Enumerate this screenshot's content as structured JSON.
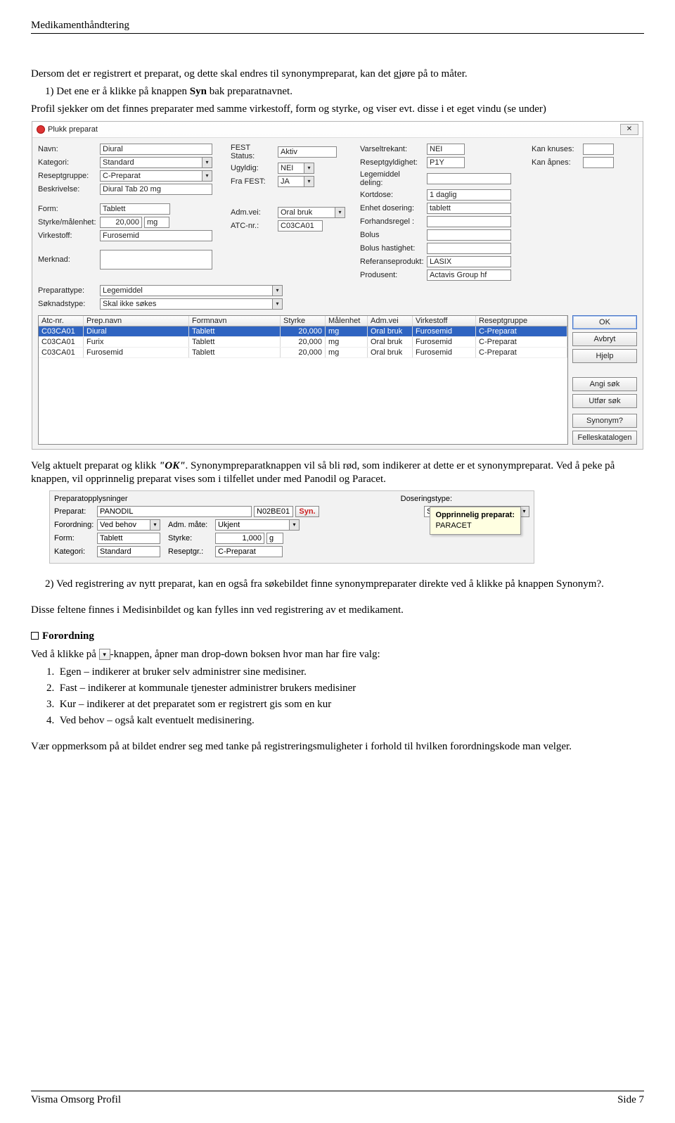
{
  "header": "Medikamenthåndtering",
  "para1": "Dersom det er registrert et preparat, og dette skal endres til synonympreparat, kan det gjøre på to måter.",
  "item1_prefix": "1)   Det ene er å klikke på knappen ",
  "item1_bold": "Syn",
  "item1_suffix": " bak preparatnavnet.",
  "para2": "Profil sjekker om det finnes preparater med samme virkestoff, form og styrke, og viser evt. disse i et eget vindu (se under)",
  "dlg1": {
    "title": "Plukk preparat",
    "close": "✕",
    "labels": {
      "navn": "Navn:",
      "kategori": "Kategori:",
      "reseptgruppe": "Reseptgruppe:",
      "beskrivelse": "Beskrivelse:",
      "form": "Form:",
      "styrke": "Styrke/målenhet:",
      "virkestoff": "Virkestoff:",
      "merknad": "Merknad:",
      "festStatus": "FEST Status:",
      "ugyldig": "Ugyldig:",
      "fraFest": "Fra FEST:",
      "admvei": "Adm.vei:",
      "atc": "ATC-nr.:",
      "varseltrekant": "Varseltrekant:",
      "reseptgyldighet": "Reseptgyldighet:",
      "legemiddeldeling": "Legemiddel deling:",
      "kortdose": "Kortdose:",
      "enhetdosering": "Enhet dosering:",
      "forhandsregel": "Forhandsregel :",
      "bolus": "Bolus",
      "bolushast": "Bolus hastighet:",
      "referanse": "Referanseprodukt:",
      "produsent": "Produsent:",
      "kanknuses": "Kan knuses:",
      "kanapnes": "Kan åpnes:",
      "preparattype": "Preparattype:",
      "soknadstype": "Søknadstype:"
    },
    "vals": {
      "navn": "Diural",
      "kategori": "Standard",
      "reseptgruppe": "C-Preparat",
      "beskrivelse": "Diural Tab 20 mg",
      "form": "Tablett",
      "styrke": "20,000",
      "styrkeUnit": "mg",
      "virkestoff": "Furosemid",
      "festStatus": "Aktiv",
      "ugyldig": "NEI",
      "fraFest": "JA",
      "admvei": "Oral bruk",
      "atc": "C03CA01",
      "varseltrekant": "NEI",
      "reseptgyldighet": "P1Y",
      "kortdose": "1 daglig",
      "enhetdosering": "tablett",
      "referanse": "LASIX",
      "produsent": "Actavis Group hf",
      "preparattype": "Legemiddel",
      "soknadstype": "Skal ikke søkes"
    },
    "grid": {
      "headers": [
        "Atc-nr.",
        "Prep.navn",
        "Formnavn",
        "Styrke",
        "Målenhet",
        "Adm.vei",
        "Virkestoff",
        "Reseptgruppe"
      ],
      "rows": [
        [
          "C03CA01",
          "Diural",
          "Tablett",
          "20,000",
          "mg",
          "Oral bruk",
          "Furosemid",
          "C-Preparat"
        ],
        [
          "C03CA01",
          "Furix",
          "Tablett",
          "20,000",
          "mg",
          "Oral bruk",
          "Furosemid",
          "C-Preparat"
        ],
        [
          "C03CA01",
          "Furosemid",
          "Tablett",
          "20,000",
          "mg",
          "Oral bruk",
          "Furosemid",
          "C-Preparat"
        ]
      ]
    },
    "buttons": {
      "ok": "OK",
      "avbryt": "Avbryt",
      "hjelp": "Hjelp",
      "angi": "Angi søk",
      "utfor": "Utfør søk",
      "synonym": "Synonym?",
      "felles": "Felleskatalogen"
    }
  },
  "para3_a": "Velg aktuelt preparat og klikk ",
  "para3_ok": "\"OK\"",
  "para3_b": ". Synonympreparatknappen vil så bli rød, som indikerer at dette er et synonympreparat. Ved å peke på knappen, vil opprinnelig preparat vises som i tilfellet under med Panodil og Paracet.",
  "dlg2": {
    "title": "Preparatopplysninger",
    "doseringstype": "Doseringstype:",
    "labels": {
      "preparat": "Preparat:",
      "forordning": "Forordning:",
      "form": "Form:",
      "kategori": "Kategori:",
      "admmate": "Adm. måte:",
      "styrke": "Styrke:",
      "reseptgr": "Reseptgr.:"
    },
    "vals": {
      "preparat": "PANODIL",
      "atc": "N02BE01",
      "syn": "Syn.",
      "doseringstype": "Standard",
      "forordning": "Ved behov",
      "admmate": "Ukjent",
      "form": "Tablett",
      "styrke": "1,000",
      "styrkeUnit": "g",
      "kategori": "Standard",
      "reseptgr": "C-Preparat"
    },
    "tooltip": {
      "line1": "Opprinnelig preparat:",
      "line2": "PARACET"
    }
  },
  "item2": "2)   Ved registrering av nytt preparat, kan en også fra søkebildet finne synonympreparater direkte ved å klikke på knappen Synonym?.",
  "para4": "Disse feltene finnes i Medisinbildet og kan fylles inn ved registrering av et medikament.",
  "section_forordning": "Forordning",
  "para5_a": "Ved å klikke på ",
  "para5_b": "-knappen, åpner man drop-down boksen hvor man har fire valg:",
  "ol": [
    "Egen – indikerer at bruker selv administrer sine medisiner.",
    "Fast – indikerer at kommunale tjenester administrer brukers medisiner",
    "Kur – indikerer at det preparatet som er registrert gis som en kur",
    "Ved behov – også kalt eventuelt medisinering."
  ],
  "para6": "Vær oppmerksom på at bildet endrer seg med tanke på registreringsmuligheter i forhold til hvilken forordningskode man velger.",
  "footer": {
    "left": "Visma Omsorg Profil",
    "right": "Side 7"
  }
}
